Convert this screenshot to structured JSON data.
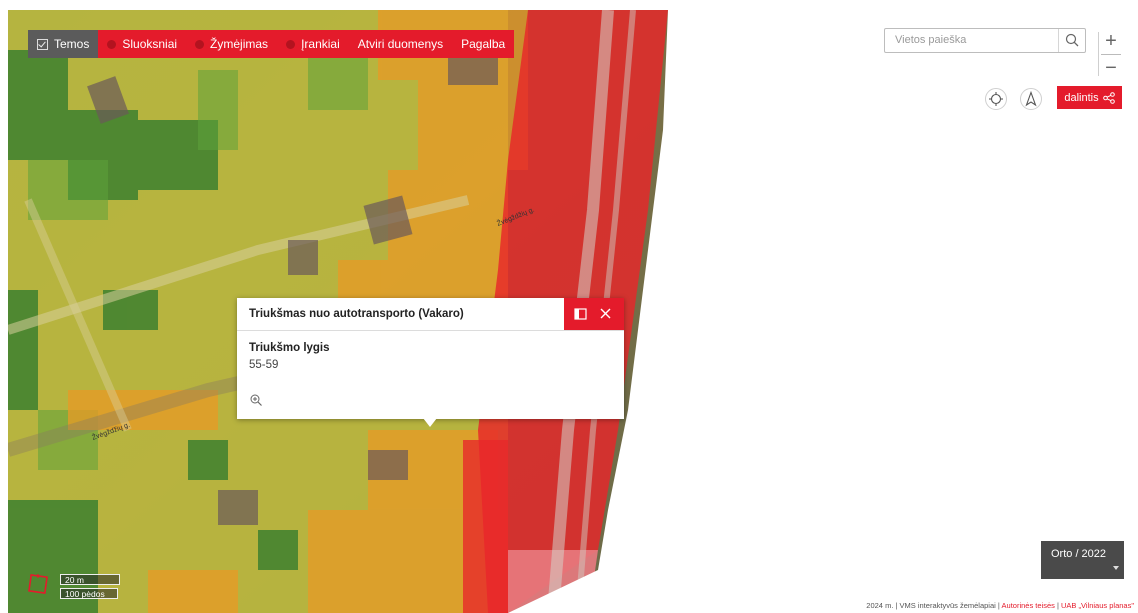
{
  "menu": {
    "items": [
      {
        "label": "Temos",
        "icon": "checkbox-icon",
        "active": true
      },
      {
        "label": "Sluoksniai",
        "icon": "layers-icon",
        "active": false
      },
      {
        "label": "Žymėjimas",
        "icon": "markup-icon",
        "active": false
      },
      {
        "label": "Įrankiai",
        "icon": "tools-icon",
        "active": false
      },
      {
        "label": "Atviri duomenys",
        "icon": "",
        "active": false
      },
      {
        "label": "Pagalba",
        "icon": "",
        "active": false
      }
    ]
  },
  "search": {
    "placeholder": "Vietos paieška",
    "icon": "search-icon"
  },
  "controls": {
    "zoom_in": "+",
    "zoom_out": "−",
    "locate_icon": "crosshair-icon",
    "north_icon": "compass-arrow-icon",
    "share_label": "dalintis",
    "share_icon": "share-icon"
  },
  "map": {
    "street_labels": [
      "Žvėgždžių g.",
      "Žvėgždžių g."
    ],
    "accent_color": "#e41b2b",
    "noise_colors": {
      "low": "#2f8a2f",
      "mid": "#d7e04a",
      "high": "#f4a21e",
      "very_high": "#e8262a"
    }
  },
  "popup": {
    "title": "Triukšmas nuo autotransporto (Vakaro)",
    "field_label": "Triukšmo lygis",
    "field_value": "55-59",
    "icons": [
      "dock-icon",
      "close-icon",
      "zoom-to-icon"
    ]
  },
  "basemap": {
    "label": "Orto / 2022"
  },
  "scale": {
    "metric": "20 m",
    "imperial": "100 pėdos"
  },
  "footer": {
    "text": "2024 m. | VMS interaktyvūs žemėlapiai | ",
    "link1": "Autorinės teisės",
    "sep": " | ",
    "link2": "UAB „Vilniaus planas\""
  }
}
